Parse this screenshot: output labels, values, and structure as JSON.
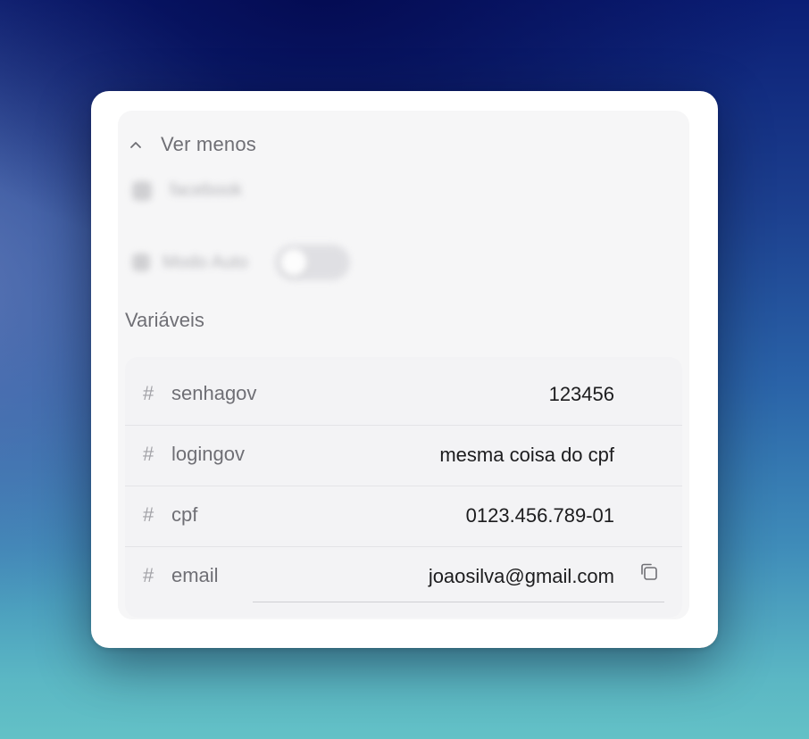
{
  "header": {
    "collapse_label": "Ver menos"
  },
  "blurred": {
    "item_label": "facebook",
    "toggle_label": "Modo Auto"
  },
  "variables": {
    "title": "Variáveis",
    "items": [
      {
        "hash": "#",
        "name": "senhagov",
        "value": "123456"
      },
      {
        "hash": "#",
        "name": "logingov",
        "value": "mesma coisa do cpf"
      },
      {
        "hash": "#",
        "name": "cpf",
        "value": "0123.456.789-01"
      },
      {
        "hash": "#",
        "name": "email",
        "value": "joaosilva@gmail.com"
      }
    ]
  },
  "icons": {
    "collapse": "chevron-up-icon",
    "copy": "copy-icon"
  },
  "colors": {
    "muted_text": "#6f6f75",
    "value_text": "#1c1c1e",
    "panel_bg": "#f6f6f7"
  }
}
